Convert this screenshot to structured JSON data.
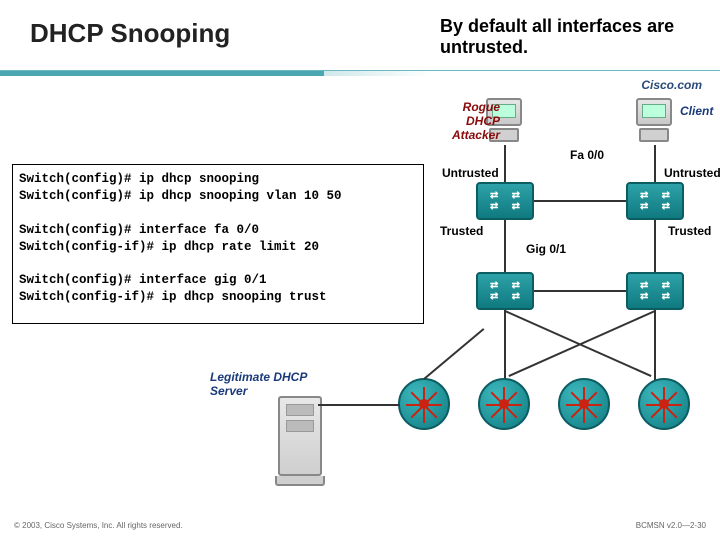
{
  "title": "DHCP Snooping",
  "note": "By default all interfaces are untrusted.",
  "brand": "Cisco.com",
  "code": "Switch(config)# ip dhcp snooping\nSwitch(config)# ip dhcp snooping vlan 10 50\n\nSwitch(config)# interface fa 0/0\nSwitch(config-if)# ip dhcp rate limit 20\n\nSwitch(config)# interface gig 0/1\nSwitch(config-if)# ip dhcp snooping trust",
  "labels": {
    "attacker": "Rogue DHCP Attacker",
    "client": "Client",
    "untrusted": "Untrusted",
    "trusted": "Trusted",
    "legit": "Legitimate DHCP Server",
    "fa00": "Fa 0/0",
    "gig01": "Gig 0/1"
  },
  "footer": {
    "left": "© 2003, Cisco Systems, Inc. All rights reserved.",
    "right": "BCMSN v2.0—2-30"
  }
}
